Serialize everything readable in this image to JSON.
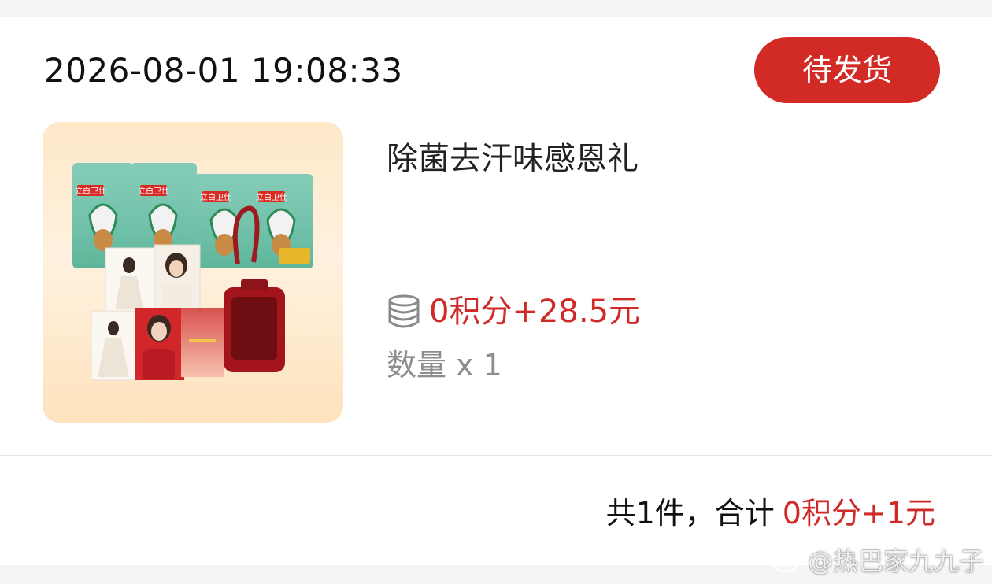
{
  "order": {
    "time": "2026-08-01 19:08:33",
    "status_label": "待发货"
  },
  "product": {
    "name": "除菌去汗味感恩礼",
    "price": "0积分+28.5元",
    "quantity_label": "数量",
    "quantity_value": "x 1",
    "image_icon": "product-bundle-image",
    "brand_label": "立白卫仕"
  },
  "summary": {
    "count_text": "共1件，合计",
    "total_text": "0积分+1元"
  },
  "watermark": {
    "text": "@热巴家九九子"
  },
  "colors": {
    "accent": "#d22a25",
    "price": "#cf2a27",
    "muted": "#8d8d8d"
  }
}
